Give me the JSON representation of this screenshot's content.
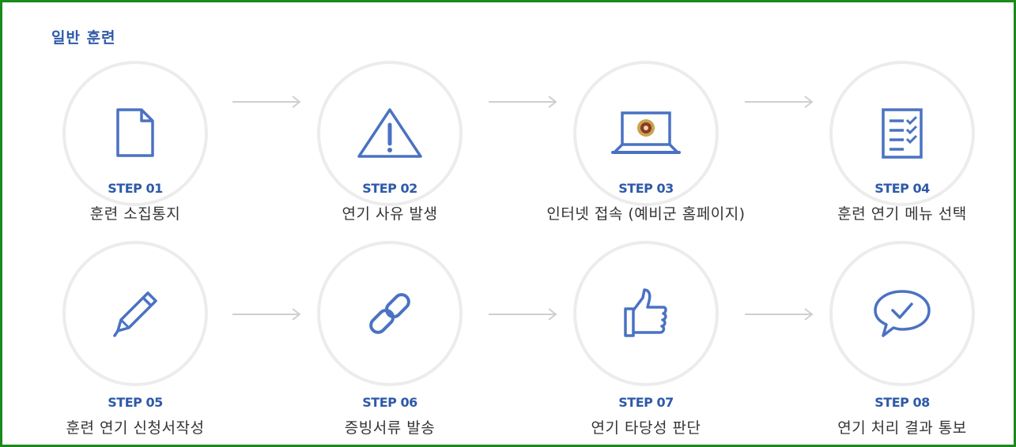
{
  "section_title": "일반 훈련",
  "colors": {
    "accent": "#2e5aa8",
    "icon": "#4a72c2",
    "circle_border": "#ececec",
    "arrow": "#cfcfcf",
    "frame": "#1a8a1a"
  },
  "steps": [
    {
      "num": "STEP 01",
      "label": "훈련 소집통지",
      "icon": "document-icon"
    },
    {
      "num": "STEP 02",
      "label": "연기 사유 발생",
      "icon": "warning-icon"
    },
    {
      "num": "STEP 03",
      "label": "인터넷 접속 (예비군 홈페이지)",
      "icon": "laptop-icon"
    },
    {
      "num": "STEP 04",
      "label": "훈련 연기 메뉴 선택",
      "icon": "checklist-icon"
    },
    {
      "num": "STEP 05",
      "label": "훈련 연기 신청서작성",
      "icon": "pencil-icon"
    },
    {
      "num": "STEP 06",
      "label": "증빙서류 발송",
      "icon": "link-icon"
    },
    {
      "num": "STEP 07",
      "label": "연기 타당성 판단",
      "icon": "thumbs-up-icon"
    },
    {
      "num": "STEP 08",
      "label": "연기 처리 결과 통보",
      "icon": "chat-check-icon"
    }
  ]
}
